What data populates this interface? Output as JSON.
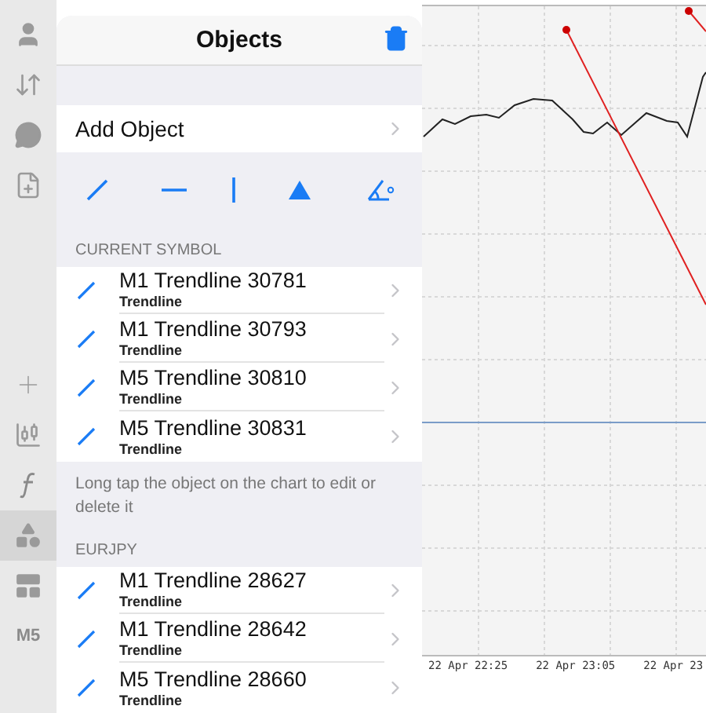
{
  "sidebar": {
    "items": [
      {
        "kind": "person",
        "selected": false
      },
      {
        "kind": "trade",
        "selected": false
      },
      {
        "kind": "chat",
        "selected": false
      },
      {
        "kind": "new",
        "selected": false
      },
      {
        "kind": "spacer"
      },
      {
        "kind": "crosshair",
        "selected": false
      },
      {
        "kind": "candles",
        "selected": false
      },
      {
        "kind": "function",
        "selected": false
      },
      {
        "kind": "objects",
        "selected": true
      },
      {
        "kind": "layout",
        "selected": false
      },
      {
        "kind": "label",
        "text": "M5",
        "selected": false
      }
    ]
  },
  "popover": {
    "title": "Objects",
    "add_object": "Add Object",
    "tools": [
      {
        "kind": "trendline"
      },
      {
        "kind": "horizontal"
      },
      {
        "kind": "vertical"
      },
      {
        "kind": "triangle"
      },
      {
        "kind": "angle"
      }
    ],
    "sections": [
      {
        "heading": "CURRENT SYMBOL",
        "items": [
          {
            "name": "M1 Trendline 30781",
            "type": "Trendline"
          },
          {
            "name": "M1 Trendline 30793",
            "type": "Trendline"
          },
          {
            "name": "M5 Trendline 30810",
            "type": "Trendline"
          },
          {
            "name": "M5 Trendline 30831",
            "type": "Trendline"
          }
        ],
        "note": "Long tap the object on the chart to edit or delete it"
      },
      {
        "heading": "EURJPY",
        "items": [
          {
            "name": "M1 Trendline 28627",
            "type": "Trendline"
          },
          {
            "name": "M1 Trendline 28642",
            "type": "Trendline"
          },
          {
            "name": "M5 Trendline 28660",
            "type": "Trendline"
          }
        ]
      }
    ]
  },
  "chart": {
    "time_labels": [
      "22 Apr 22:25",
      "22 Apr 23:05",
      "22 Apr 23"
    ]
  }
}
